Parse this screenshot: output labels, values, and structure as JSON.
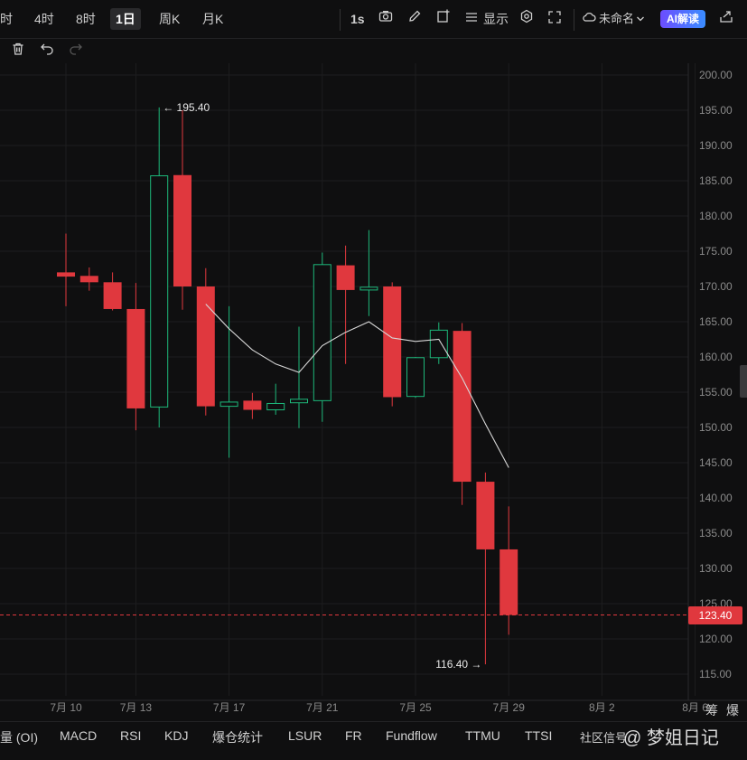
{
  "toolbar": {
    "timeframes": [
      "时",
      "4时",
      "8时",
      "1日",
      "周K",
      "月K"
    ],
    "active_timeframe": "1日",
    "interval_label": "1s",
    "display_label": "显示",
    "layout_name": "未命名",
    "ai_label": "AI解读"
  },
  "chart_data": {
    "type": "candlestick",
    "y_ticks": [
      "200.00",
      "195.00",
      "190.00",
      "185.00",
      "180.00",
      "175.00",
      "170.00",
      "165.00",
      "160.00",
      "155.00",
      "150.00",
      "145.00",
      "140.00",
      "135.00",
      "130.00",
      "125.00",
      "120.00",
      "115.00"
    ],
    "y_range": [
      113,
      202
    ],
    "x_ticks": [
      {
        "label": "7月 10",
        "index": 0
      },
      {
        "label": "7月 13",
        "index": 3
      },
      {
        "label": "7月 17",
        "index": 7
      },
      {
        "label": "7月 21",
        "index": 11
      },
      {
        "label": "7月 25",
        "index": 15
      },
      {
        "label": "7月 29",
        "index": 19
      },
      {
        "label": "8月 2",
        "index": 23
      },
      {
        "label": "8月 6",
        "index": 27
      }
    ],
    "candles": [
      {
        "o": 172.0,
        "h": 177.5,
        "l": 167.2,
        "c": 171.4
      },
      {
        "o": 171.5,
        "h": 172.7,
        "l": 169.4,
        "c": 170.6
      },
      {
        "o": 170.6,
        "h": 172.0,
        "l": 166.6,
        "c": 166.8
      },
      {
        "o": 166.8,
        "h": 170.5,
        "l": 149.6,
        "c": 152.7
      },
      {
        "o": 152.9,
        "h": 195.4,
        "l": 150.0,
        "c": 185.7
      },
      {
        "o": 185.8,
        "h": 195.0,
        "l": 166.7,
        "c": 170.0
      },
      {
        "o": 170.0,
        "h": 172.6,
        "l": 151.7,
        "c": 153.0
      },
      {
        "o": 153.0,
        "h": 167.2,
        "l": 145.7,
        "c": 153.6
      },
      {
        "o": 153.8,
        "h": 154.9,
        "l": 151.2,
        "c": 152.5
      },
      {
        "o": 152.5,
        "h": 156.2,
        "l": 151.8,
        "c": 153.4
      },
      {
        "o": 153.5,
        "h": 164.3,
        "l": 149.9,
        "c": 154.0
      },
      {
        "o": 153.8,
        "h": 174.8,
        "l": 150.8,
        "c": 173.1
      },
      {
        "o": 173.0,
        "h": 175.8,
        "l": 159.0,
        "c": 169.5
      },
      {
        "o": 169.5,
        "h": 178.0,
        "l": 165.8,
        "c": 169.9
      },
      {
        "o": 170.0,
        "h": 170.6,
        "l": 153.0,
        "c": 154.3
      },
      {
        "o": 154.4,
        "h": 160.0,
        "l": 154.2,
        "c": 159.9
      },
      {
        "o": 159.9,
        "h": 164.9,
        "l": 159.0,
        "c": 163.8
      },
      {
        "o": 163.7,
        "h": 164.8,
        "l": 139.0,
        "c": 142.3
      },
      {
        "o": 142.3,
        "h": 143.6,
        "l": 116.4,
        "c": 132.7
      },
      {
        "o": 132.7,
        "h": 138.8,
        "l": 120.6,
        "c": 123.4
      }
    ],
    "ma_line": [
      null,
      null,
      null,
      null,
      null,
      null,
      167.5,
      164.0,
      161.0,
      159.0,
      157.8,
      161.6,
      163.5,
      165.0,
      162.7,
      162.2,
      162.5,
      157.0,
      150.5,
      144.3
    ],
    "max_label": "195.40",
    "min_label": "116.40",
    "current_price": "123.40",
    "max_index": 4,
    "min_index": 18,
    "colors": {
      "up": "#1db87a",
      "down": "#e0383e",
      "ma": "#d8d8d8",
      "grid": "#1d1d1f",
      "axis_text": "#8a8a8a"
    }
  },
  "bottom_bar": {
    "indicators": [
      "量 (OI)",
      "MACD",
      "RSI",
      "KDJ",
      "爆仓统计",
      "LSUR",
      "FR",
      "Fundflow",
      "TTMU",
      "TTSI",
      "社区信号"
    ],
    "side_label_1": "筹",
    "side_label_2": "爆",
    "watermark": "@ 梦姐日记"
  }
}
